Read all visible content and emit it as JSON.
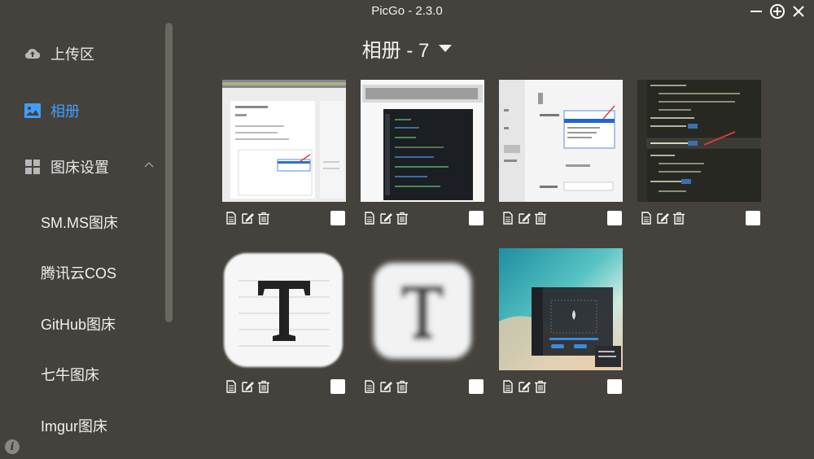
{
  "app": {
    "title": "PicGo - 2.3.0"
  },
  "window_controls": [
    {
      "name": "minimize-icon"
    },
    {
      "name": "add-window-icon"
    },
    {
      "name": "close-icon"
    }
  ],
  "sidebar": {
    "upload": {
      "label": "上传区",
      "icon": "cloud-upload-icon"
    },
    "gallery": {
      "label": "相册",
      "icon": "image-icon",
      "active": true
    },
    "settings_group": {
      "label": "图床设置",
      "icon": "grid-icon",
      "expanded": true
    },
    "sub_items": [
      "SM.MS图床",
      "腾讯云COS",
      "GitHub图床",
      "七牛图床",
      "Imgur图床"
    ]
  },
  "gallery": {
    "title": "相册 - 7",
    "images": [
      {
        "name": "screenshot-settings-page"
      },
      {
        "name": "screenshot-code-editor"
      },
      {
        "name": "screenshot-dropdown-menu"
      },
      {
        "name": "screenshot-config-file"
      },
      {
        "name": "typora-icon"
      },
      {
        "name": "typora-icon-blurred"
      },
      {
        "name": "screenshot-beach-upload"
      }
    ]
  },
  "colors": {
    "background": "#45413c",
    "accent": "#409eff"
  }
}
